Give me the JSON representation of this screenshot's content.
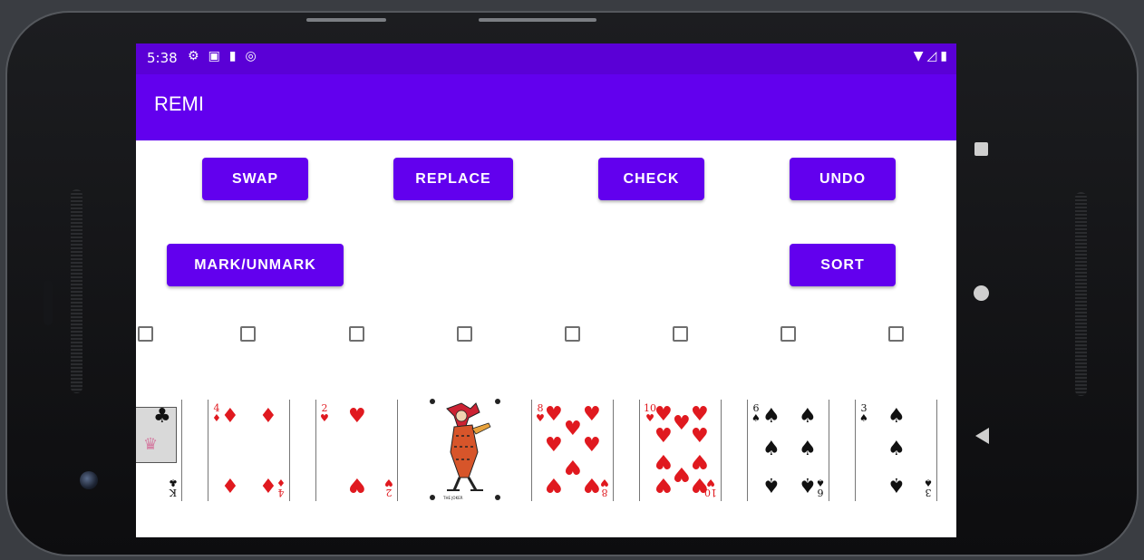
{
  "status_bar": {
    "time": "5:38",
    "icons": [
      "gear-icon",
      "photo-icon",
      "sd-card-icon",
      "sync-icon"
    ],
    "right_icons": [
      "wifi-icon",
      "signal-icon",
      "battery-icon"
    ]
  },
  "app": {
    "title": "REMI",
    "accent": "#6200ee",
    "status_color": "#5a00d6"
  },
  "buttons": {
    "swap": "SWAP",
    "replace": "REPLACE",
    "check": "CHECK",
    "undo": "UNDO",
    "mark_unmark": "MARK/UNMARK",
    "sort": "SORT"
  },
  "cards": [
    {
      "rank": "K",
      "suit": "♣",
      "color": "black",
      "kind": "face"
    },
    {
      "rank": "4",
      "suit": "♦",
      "color": "red",
      "kind": "number"
    },
    {
      "rank": "2",
      "suit": "♥",
      "color": "red",
      "kind": "number"
    },
    {
      "rank": "",
      "suit": "",
      "color": "black",
      "kind": "joker",
      "caption": "THE JOKER"
    },
    {
      "rank": "8",
      "suit": "♥",
      "color": "red",
      "kind": "number"
    },
    {
      "rank": "10",
      "suit": "♥",
      "color": "red",
      "kind": "number"
    },
    {
      "rank": "6",
      "suit": "♠",
      "color": "black",
      "kind": "number"
    },
    {
      "rank": "3",
      "suit": "♠",
      "color": "black",
      "kind": "number"
    }
  ],
  "checkboxes": [
    false,
    false,
    false,
    false,
    false,
    false,
    false,
    false
  ],
  "nav": {
    "recents": "square-icon",
    "home": "circle-icon",
    "back": "triangle-back-icon"
  }
}
